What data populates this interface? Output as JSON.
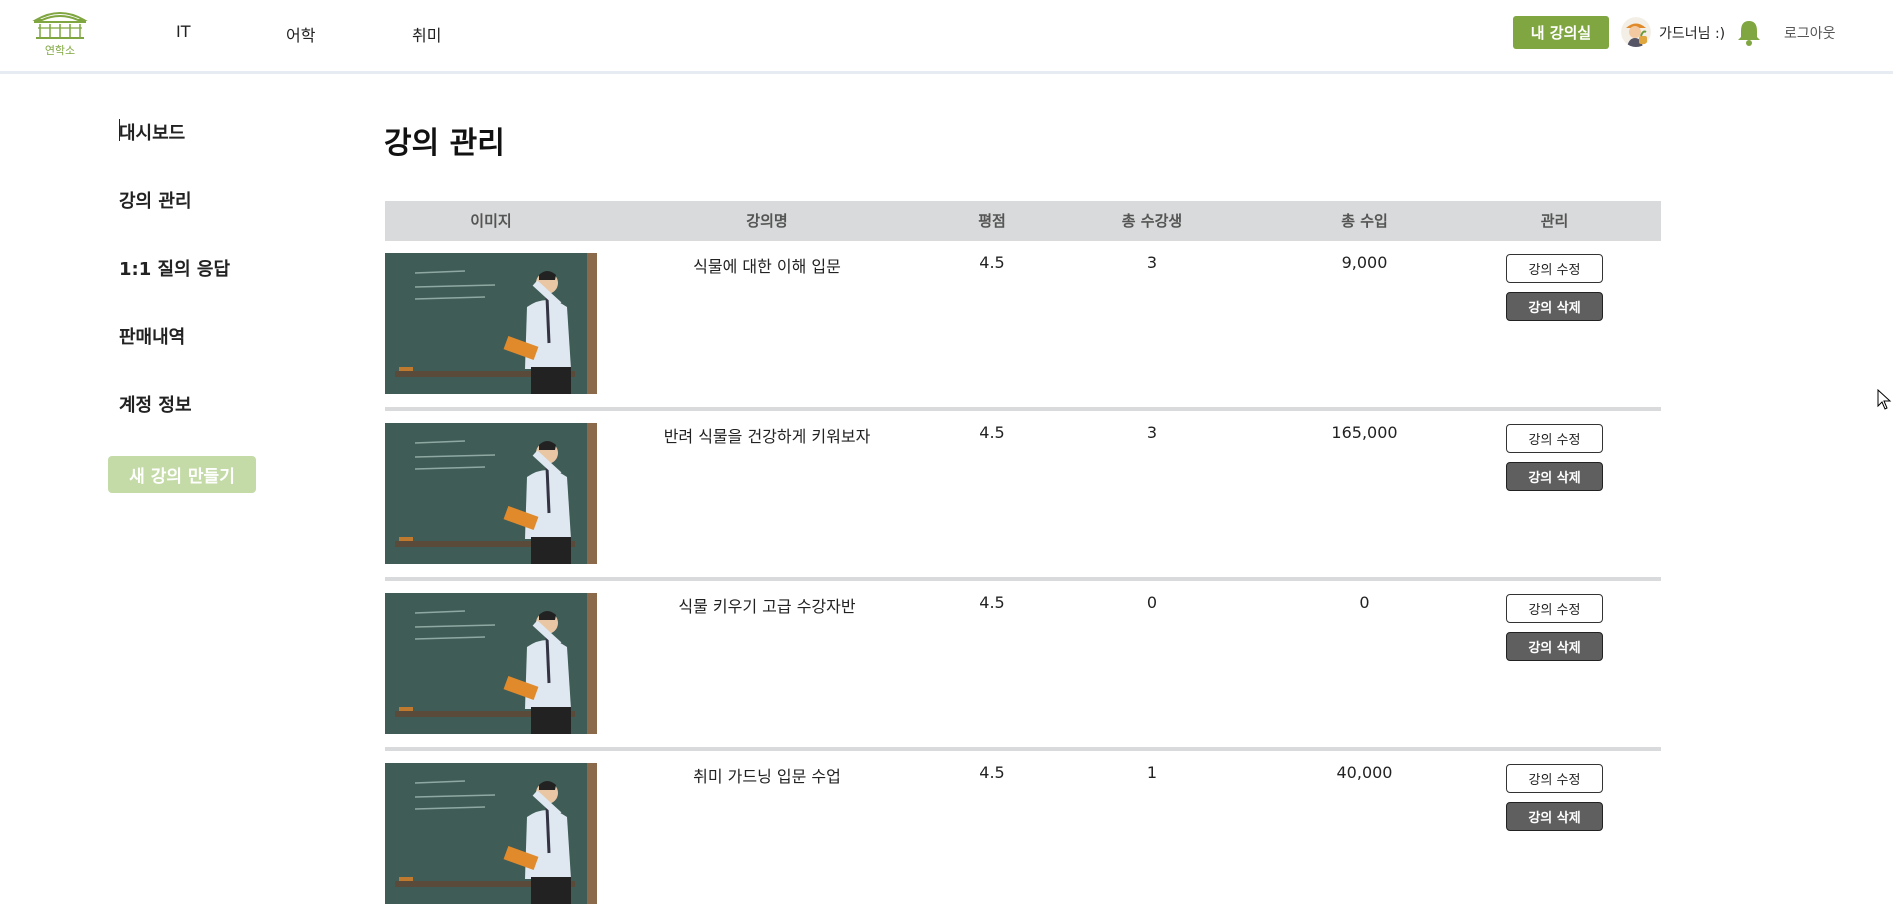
{
  "header": {
    "logo_text": "연학소",
    "nav": [
      "IT",
      "어학",
      "취미"
    ],
    "my_class_label": "내 강의실",
    "username": "가드너님 :)",
    "logout_label": "로그아웃",
    "accent_color": "#7fa640"
  },
  "sidebar": {
    "items": [
      {
        "label": "대시보드"
      },
      {
        "label": "강의 관리"
      },
      {
        "label": "1:1 질의 응답"
      },
      {
        "label": "판매내역"
      },
      {
        "label": "계정 정보"
      }
    ],
    "new_course_label": "새 강의 만들기"
  },
  "main": {
    "title": "강의 관리",
    "columns": [
      "이미지",
      "강의명",
      "평점",
      "총 수강생",
      "총 수입",
      "관리"
    ],
    "rows": [
      {
        "name": "식물에 대한 이해 입문",
        "rating": "4.5",
        "students": "3",
        "revenue": "9,000"
      },
      {
        "name": "반려 식물을 건강하게 키워보자",
        "rating": "4.5",
        "students": "3",
        "revenue": "165,000"
      },
      {
        "name": "식물 키우기 고급 수강자반",
        "rating": "4.5",
        "students": "0",
        "revenue": "0"
      },
      {
        "name": "취미 가드닝 입문 수업",
        "rating": "4.5",
        "students": "1",
        "revenue": "40,000"
      }
    ],
    "edit_label": "강의 수정",
    "delete_label": "강의 삭제"
  }
}
